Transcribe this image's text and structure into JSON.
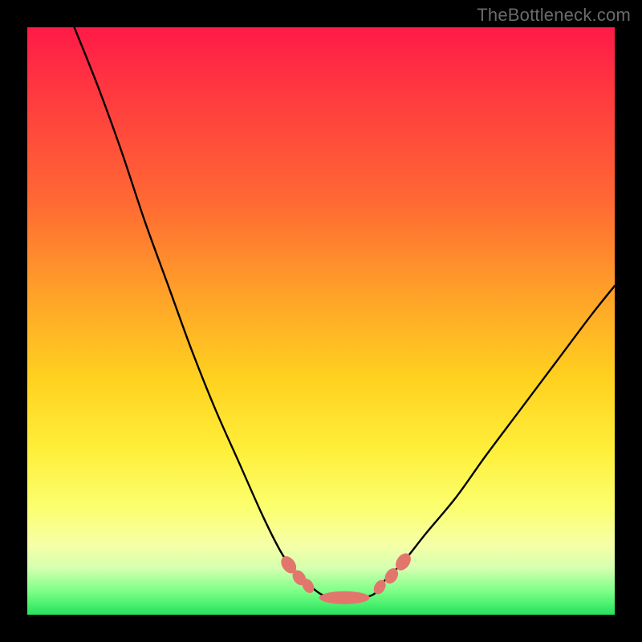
{
  "watermark": "TheBottleneck.com",
  "chart_data": {
    "type": "line",
    "title": "",
    "xlabel": "",
    "ylabel": "",
    "xlim": [
      0,
      100
    ],
    "ylim": [
      0,
      100
    ],
    "gradient_stops": [
      {
        "pos": 0,
        "color": "#ff1a47"
      },
      {
        "pos": 12,
        "color": "#ff3b3f"
      },
      {
        "pos": 30,
        "color": "#ff6a33"
      },
      {
        "pos": 45,
        "color": "#ffa029"
      },
      {
        "pos": 60,
        "color": "#ffd21f"
      },
      {
        "pos": 72,
        "color": "#ffef3a"
      },
      {
        "pos": 82,
        "color": "#fbff70"
      },
      {
        "pos": 88,
        "color": "#f6ffa6"
      },
      {
        "pos": 92,
        "color": "#d6ffb0"
      },
      {
        "pos": 96,
        "color": "#7cff88"
      },
      {
        "pos": 100,
        "color": "#24e35c"
      }
    ],
    "series": [
      {
        "name": "left-branch",
        "x": [
          8,
          12,
          16,
          20,
          24,
          28,
          32,
          36,
          40,
          43,
          45,
          47
        ],
        "y": [
          100,
          90,
          79,
          67,
          56,
          45,
          35,
          26,
          17,
          11,
          8,
          6
        ]
      },
      {
        "name": "valley-floor",
        "x": [
          47,
          50,
          53,
          56,
          59,
          61
        ],
        "y": [
          6,
          3.5,
          2.8,
          2.8,
          3.5,
          6
        ]
      },
      {
        "name": "right-branch",
        "x": [
          61,
          64,
          68,
          73,
          78,
          84,
          90,
          96,
          100
        ],
        "y": [
          6,
          9,
          14,
          20,
          27,
          35,
          43,
          51,
          56
        ]
      }
    ],
    "markers": {
      "name": "valley-nodes",
      "color": "#e2766c",
      "points": [
        {
          "x": 44.5,
          "y": 8.5,
          "rx": 1.1,
          "ry": 1.6,
          "rot": -35
        },
        {
          "x": 46.3,
          "y": 6.3,
          "rx": 1.0,
          "ry": 1.4,
          "rot": -35
        },
        {
          "x": 47.8,
          "y": 4.9,
          "rx": 0.9,
          "ry": 1.3,
          "rot": -30
        },
        {
          "x": 54.0,
          "y": 2.9,
          "rx": 4.3,
          "ry": 1.1,
          "rot": 0
        },
        {
          "x": 60.0,
          "y": 4.7,
          "rx": 0.9,
          "ry": 1.3,
          "rot": 30
        },
        {
          "x": 62.0,
          "y": 6.6,
          "rx": 1.0,
          "ry": 1.4,
          "rot": 32
        },
        {
          "x": 64.0,
          "y": 9.0,
          "rx": 1.1,
          "ry": 1.6,
          "rot": 35
        }
      ]
    }
  }
}
